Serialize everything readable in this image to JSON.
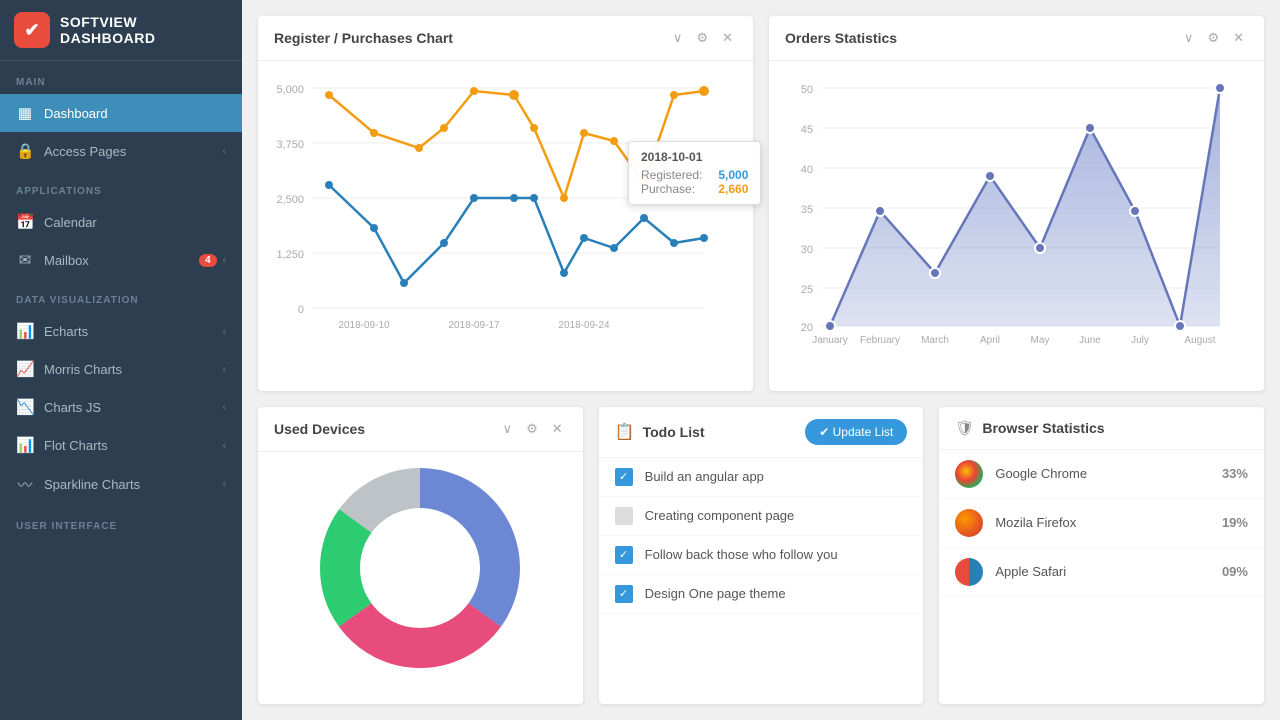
{
  "sidebar": {
    "logo": {
      "icon": "✔",
      "text": "SOFTVIEW DASHBOARD"
    },
    "sections": [
      {
        "label": "MAIN",
        "items": [
          {
            "id": "dashboard",
            "icon": "▦",
            "label": "Dashboard",
            "active": true
          },
          {
            "id": "access-pages",
            "icon": "🔒",
            "label": "Access Pages",
            "chevron": "‹",
            "active": false
          }
        ]
      },
      {
        "label": "APPLICATIONS",
        "items": [
          {
            "id": "calendar",
            "icon": "📅",
            "label": "Calendar",
            "active": false
          },
          {
            "id": "mailbox",
            "icon": "✉",
            "label": "Mailbox",
            "badge": "4",
            "chevron": "‹",
            "active": false
          }
        ]
      },
      {
        "label": "DATA VISUALIZATION",
        "items": [
          {
            "id": "echarts",
            "icon": "📊",
            "label": "Echarts",
            "chevron": "‹",
            "active": false
          },
          {
            "id": "morris-charts",
            "icon": "📈",
            "label": "Morris Charts",
            "chevron": "‹",
            "active": false
          },
          {
            "id": "charts-js",
            "icon": "📉",
            "label": "Charts JS",
            "chevron": "‹",
            "active": false
          },
          {
            "id": "flot-charts",
            "icon": "📊",
            "label": "Flot Charts",
            "chevron": "‹",
            "active": false
          },
          {
            "id": "sparkline-charts",
            "icon": "〰",
            "label": "Sparkline Charts",
            "chevron": "‹",
            "active": false
          }
        ]
      },
      {
        "label": "USER INTERFACE",
        "items": []
      }
    ]
  },
  "register_chart": {
    "title": "Register / Purchases Chart",
    "tooltip": {
      "date": "2018-10-01",
      "registered_label": "Registered:",
      "registered_value": "5,000",
      "purchase_label": "Purchase:",
      "purchase_value": "2,660"
    }
  },
  "orders_chart": {
    "title": "Orders Statistics"
  },
  "used_devices": {
    "title": "Used Devices"
  },
  "todo": {
    "title": "Todo List",
    "button_label": "✔ Update List",
    "items": [
      {
        "text": "Build an angular app",
        "checked": true
      },
      {
        "text": "Creating component page",
        "checked": false
      },
      {
        "text": "Follow back those who follow you",
        "checked": true
      },
      {
        "text": "Design One page theme",
        "checked": true
      }
    ]
  },
  "browser_stats": {
    "title": "Browser Statistics",
    "items": [
      {
        "name": "Google Chrome",
        "pct": "33%",
        "color": "#f39c12"
      },
      {
        "name": "Mozila Firefox",
        "pct": "19%",
        "color": "#e74c3c"
      },
      {
        "name": "Apple Safari",
        "pct": "09%",
        "color": "#3498db"
      }
    ]
  },
  "controls": {
    "chevron_down": "∨",
    "gear": "⚙",
    "close": "✕"
  }
}
